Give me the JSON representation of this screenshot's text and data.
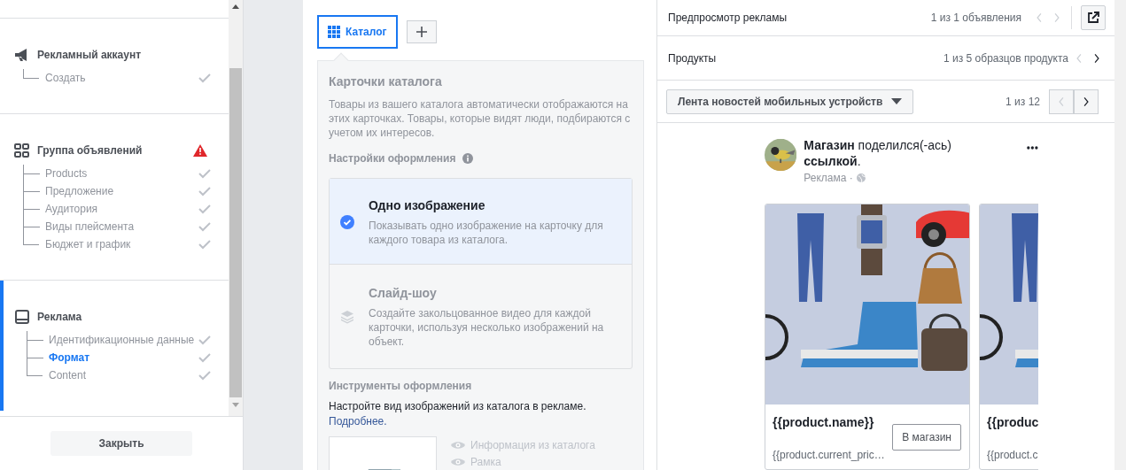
{
  "sidebar": {
    "sections": [
      {
        "title": "Рекламный аккаунт",
        "kind": "account",
        "warning": false,
        "active": false,
        "items": [
          {
            "label": "Создать",
            "selected": false,
            "done": true
          }
        ]
      },
      {
        "title": "Группа объявлений",
        "kind": "adset",
        "warning": true,
        "active": false,
        "items": [
          {
            "label": "Products",
            "selected": false,
            "done": true
          },
          {
            "label": "Предложение",
            "selected": false,
            "done": true
          },
          {
            "label": "Аудитория",
            "selected": false,
            "done": true
          },
          {
            "label": "Виды плейсмента",
            "selected": false,
            "done": true
          },
          {
            "label": "Бюджет и график",
            "selected": false,
            "done": true
          }
        ]
      },
      {
        "title": "Реклама",
        "kind": "ad",
        "warning": false,
        "active": true,
        "items": [
          {
            "label": "Идентификационные данные",
            "selected": false,
            "done": true
          },
          {
            "label": "Формат",
            "selected": true,
            "done": true
          },
          {
            "label": "Content",
            "selected": false,
            "done": true
          }
        ]
      }
    ],
    "close_button": "Закрыть"
  },
  "editor": {
    "tabs": [
      {
        "label": "Каталог",
        "selected": true
      }
    ],
    "card": {
      "title": "Карточки каталога",
      "description": "Товары из вашего каталога автоматически отображаются на этих карточках. Товары, которые видят люди, подбираются с учетом их интересов.",
      "settings_label": "Настройки оформления",
      "options": [
        {
          "title": "Одно изображение",
          "description": "Показывать одно изображение на карточку для каждого товара из каталога.",
          "selected": true
        },
        {
          "title": "Слайд-шоу",
          "description": "Создайте закольцованное видео для каждой карточки, используя несколько изображений на объект.",
          "selected": false
        }
      ],
      "tools_title": "Инструменты оформления",
      "tools_text": "Настройте вид изображений из каталога в рекламе.",
      "tools_link": "Подробнее.",
      "tools_options": [
        {
          "label": "Информация из каталога"
        },
        {
          "label": "Рамка"
        }
      ]
    }
  },
  "preview": {
    "title": "Предпросмотр рекламы",
    "ads_counter": "1 из 1 объявления",
    "ads_prev_disabled": true,
    "ads_next_disabled": true,
    "products_label": "Продукты",
    "products_counter": "1 из 5 образцов продукта",
    "products_prev_disabled": true,
    "products_next_disabled": false,
    "placement": "Лента новостей мобильных устройств",
    "placement_counter": "1 из 12",
    "placement_prev_disabled": true,
    "placement_next_disabled": false,
    "post": {
      "text": "**Магазин** поделился(-ась) **ссылкой**.",
      "sponsored": "Реклама ·",
      "cards": [
        {
          "name": "{{product.name}}",
          "price": "{{product.current_pric…",
          "button": "В магазин"
        },
        {
          "name": "{{produc",
          "price": "{{product.c"
        }
      ]
    }
  }
}
